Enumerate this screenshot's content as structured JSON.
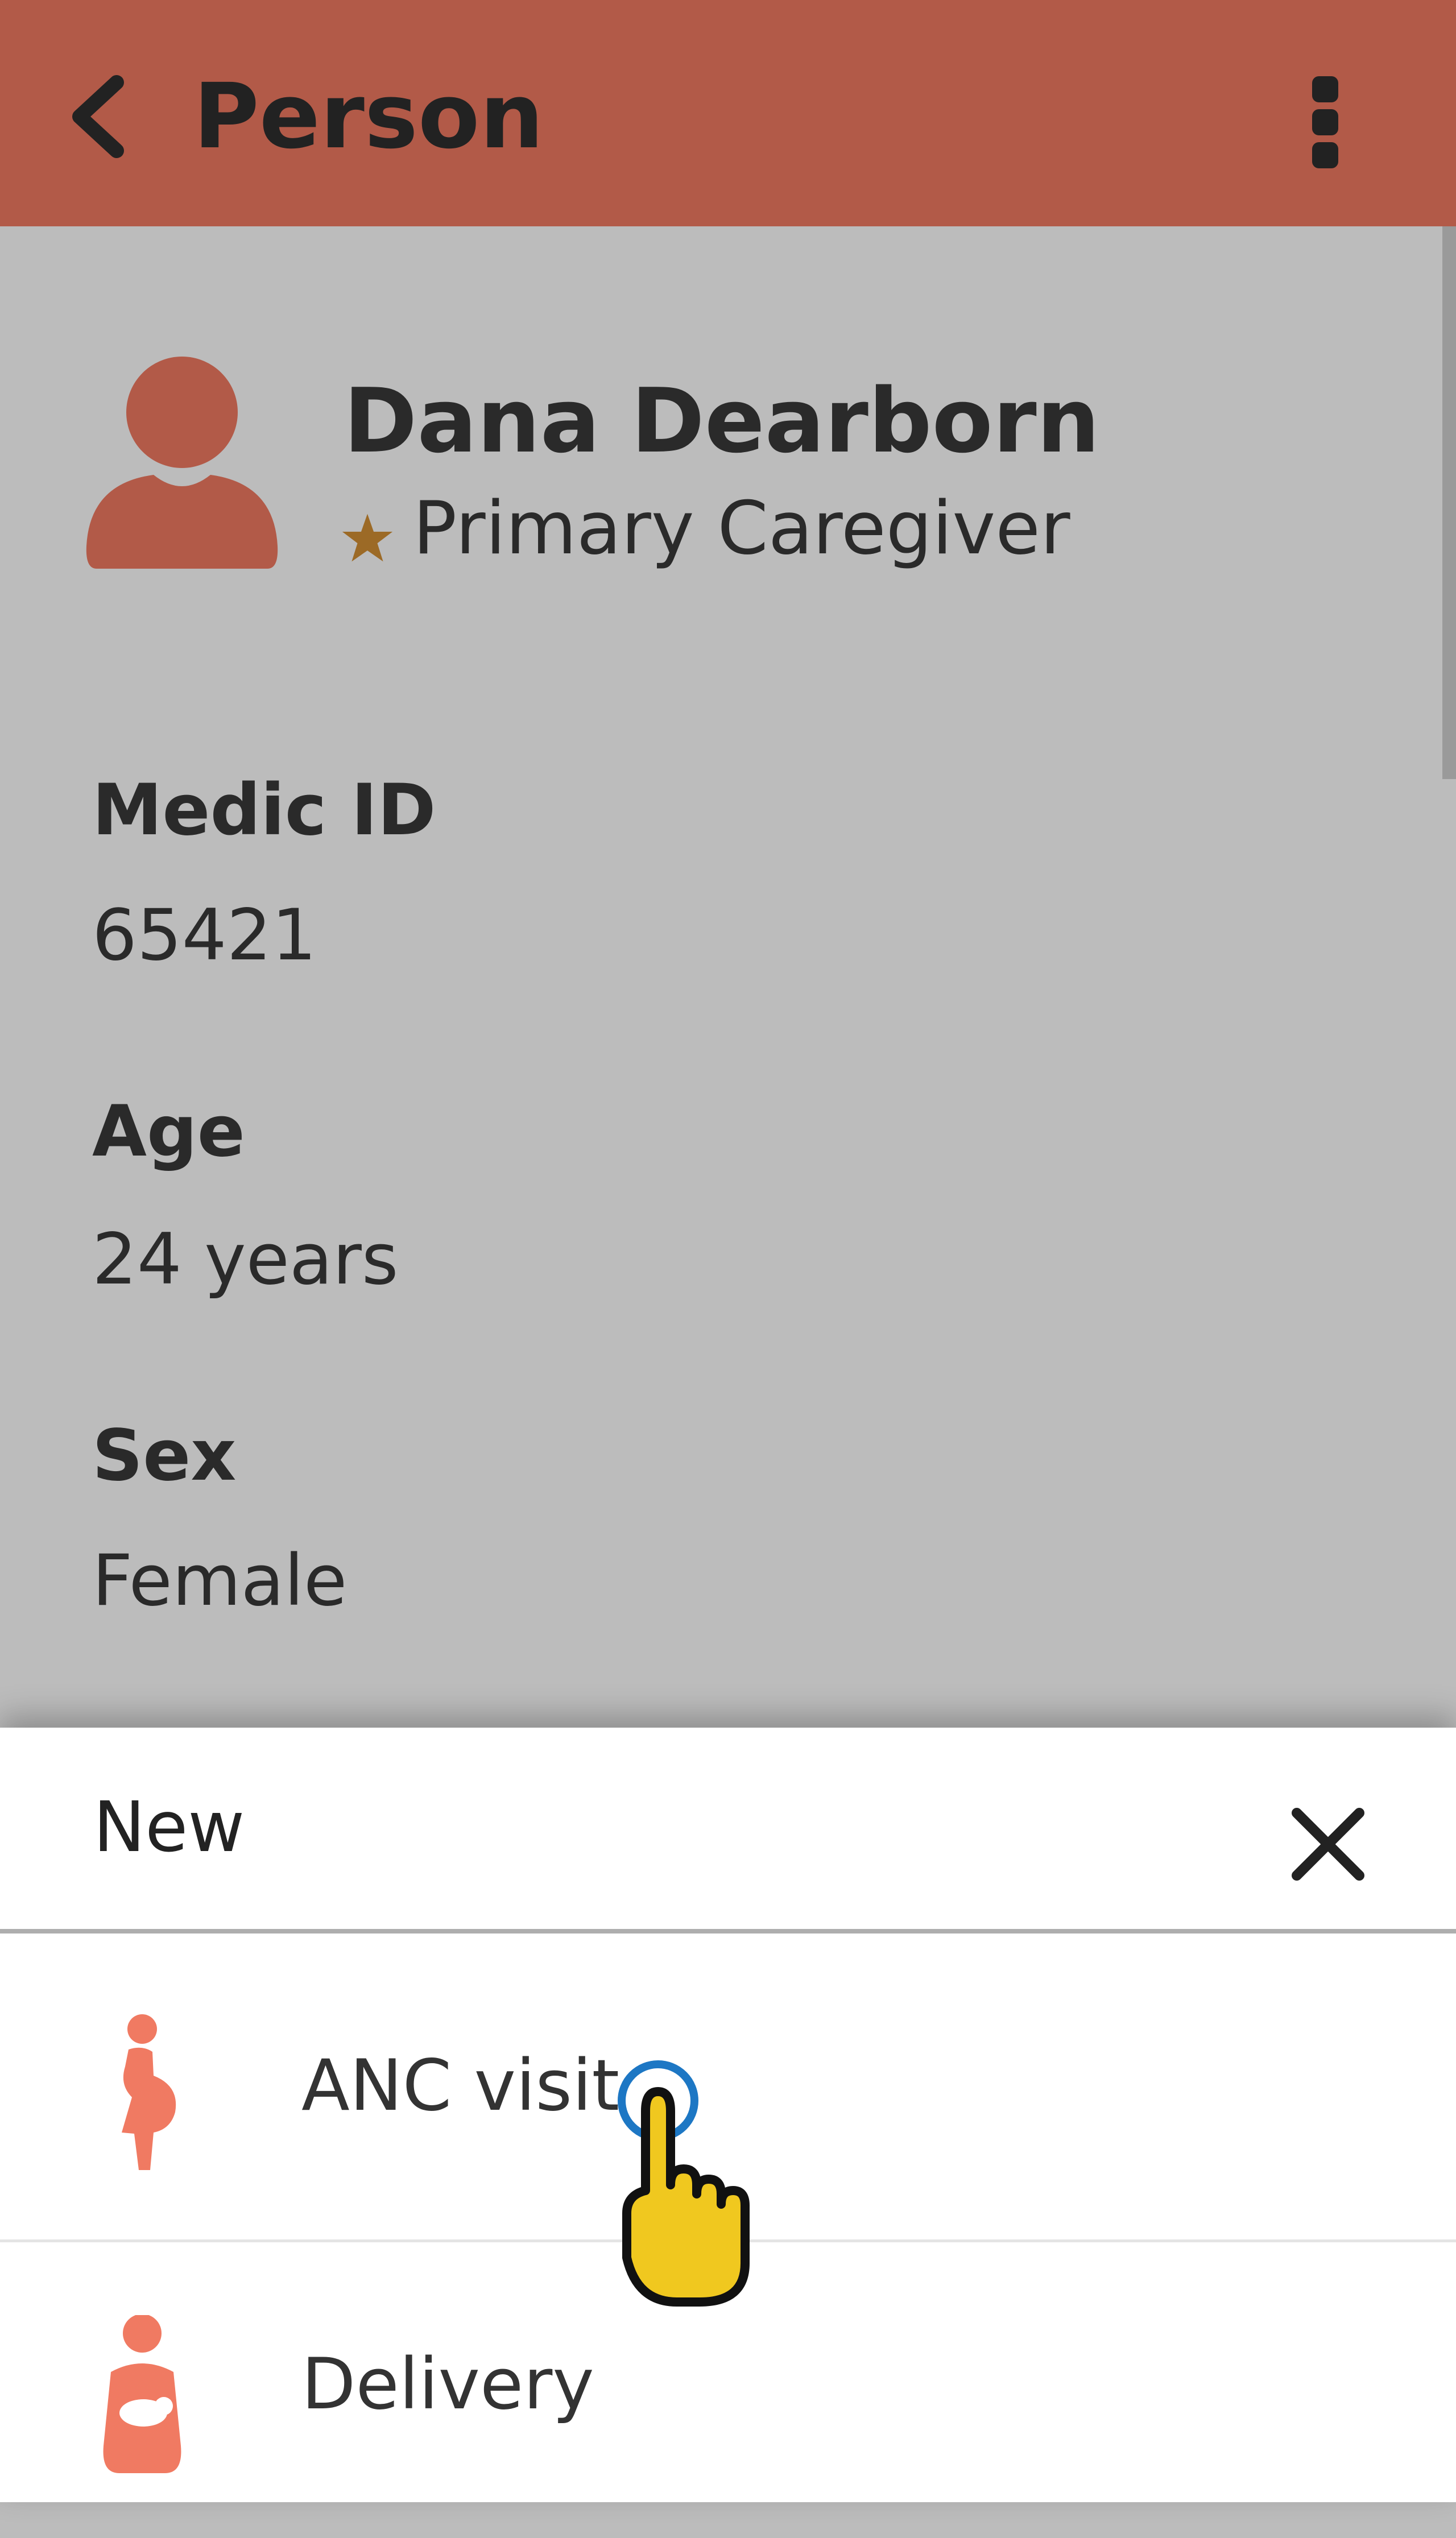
{
  "header": {
    "title": "Person",
    "back_icon": "chevron-left-icon",
    "menu_icon": "more-vert-icon"
  },
  "profile": {
    "name": "Dana Dearborn",
    "role": "Primary Caregiver",
    "star_color": "#9c6a26",
    "avatar_color": "#b25a48"
  },
  "fields": [
    {
      "label": "Medic ID",
      "value": "65421"
    },
    {
      "label": "Age",
      "value": "24 years"
    },
    {
      "label": "Sex",
      "value": "Female"
    }
  ],
  "new_sheet": {
    "title": "New",
    "close_icon": "close-icon",
    "actions": [
      {
        "label": "ANC visit",
        "icon": "pregnancy-icon",
        "icon_color": "#f07a62"
      },
      {
        "label": "Delivery",
        "icon": "delivery-icon",
        "icon_color": "#f07a62"
      }
    ]
  },
  "colors": {
    "appbar": "#b25a48",
    "overlay": "#bcbcbc"
  }
}
